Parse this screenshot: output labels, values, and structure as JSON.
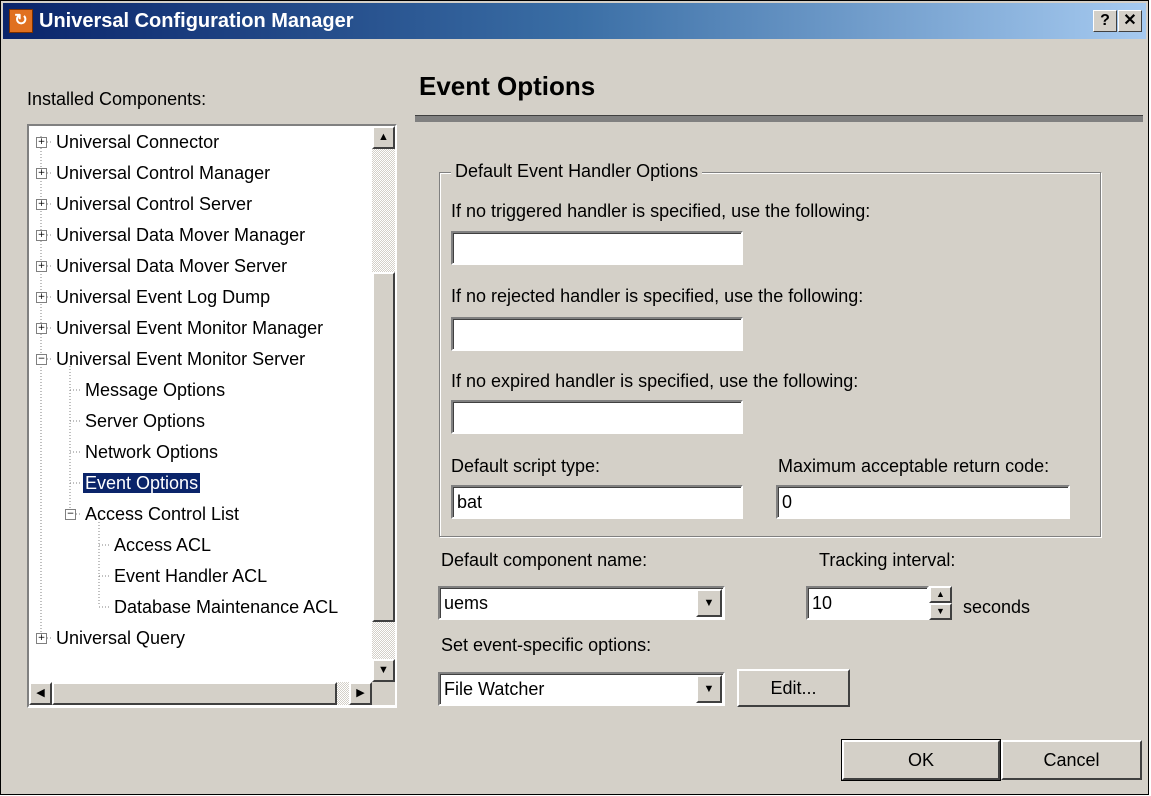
{
  "window": {
    "title": "Universal Configuration Manager",
    "help_label": "?",
    "close_label": "✕",
    "app_icon": "↻"
  },
  "sidebar": {
    "label": "Installed Components:",
    "items": [
      {
        "label": "Universal Connector",
        "expander": "+"
      },
      {
        "label": "Universal Control Manager",
        "expander": "+"
      },
      {
        "label": "Universal Control Server",
        "expander": "+"
      },
      {
        "label": "Universal Data Mover Manager",
        "expander": "+"
      },
      {
        "label": "Universal Data Mover Server",
        "expander": "+"
      },
      {
        "label": "Universal Event Log Dump",
        "expander": "+"
      },
      {
        "label": "Universal Event Monitor Manager",
        "expander": "+"
      },
      {
        "label": "Universal Event Monitor Server",
        "expander": "−"
      },
      {
        "label": "Message Options"
      },
      {
        "label": "Server Options"
      },
      {
        "label": "Network Options"
      },
      {
        "label": "Event Options"
      },
      {
        "label": "Access Control List",
        "expander": "−"
      },
      {
        "label": "Access ACL"
      },
      {
        "label": "Event Handler ACL"
      },
      {
        "label": "Database Maintenance ACL"
      },
      {
        "label": "Universal Query",
        "expander": "+"
      }
    ],
    "selected": "Event Options",
    "scroll_up": "▲",
    "scroll_down": "▼",
    "scroll_left": "◀",
    "scroll_right": "▶"
  },
  "page": {
    "heading": "Event Options"
  },
  "handler_group": {
    "title": "Default Event Handler Options",
    "triggered_label": "If no triggered handler is specified, use the following:",
    "triggered_value": "",
    "rejected_label": "If no rejected handler is specified, use the following:",
    "rejected_value": "",
    "expired_label": "If no expired handler is specified, use the following:",
    "expired_value": "",
    "script_type_label": "Default script type:",
    "script_type_value": "bat",
    "max_rc_label": "Maximum acceptable return code:",
    "max_rc_value": "0"
  },
  "component": {
    "label": "Default component name:",
    "value": "uems",
    "arrow": "▼"
  },
  "tracking": {
    "label": "Tracking interval:",
    "value": "10",
    "unit": "seconds",
    "up": "▲",
    "down": "▼"
  },
  "event_specific": {
    "label": "Set event-specific options:",
    "value": "File Watcher",
    "arrow": "▼",
    "edit_label": "Edit..."
  },
  "footer": {
    "ok_label": "OK",
    "cancel_label": "Cancel"
  }
}
